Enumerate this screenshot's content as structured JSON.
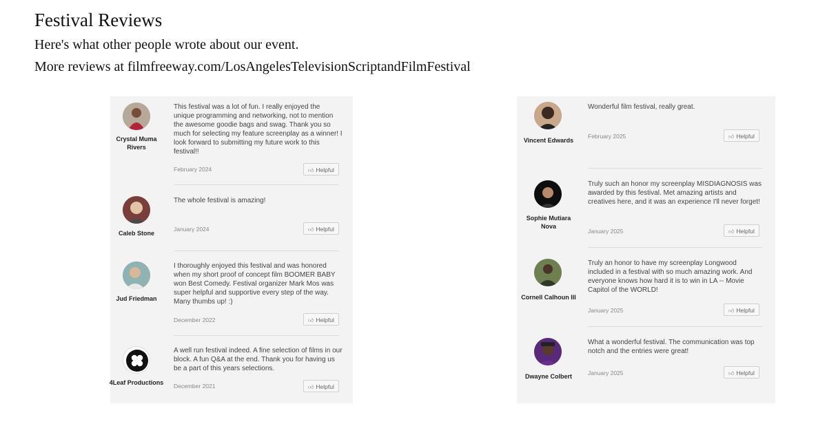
{
  "header": {
    "title": "Festival Reviews",
    "subtitle": "Here's what other people wrote about our event.",
    "more": "More reviews at filmfreeway.com/LosAngelesTelevisionScriptandFilmFestival"
  },
  "helpful_label": "Helpful",
  "left_reviews": [
    {
      "name": "Crystal Muma Rivers",
      "text": "This festival was a lot of fun. I really enjoyed the unique programming and networking, not to mention the awesome goodie bags and swag. Thank you so much for selecting my feature screenplay as a winner! I look forward to submitting my future work to this festival!!",
      "date": "February 2024",
      "avatar": "photo"
    },
    {
      "name": "Caleb Stone",
      "text": "The whole festival is amazing!",
      "date": "January 2024",
      "avatar": "photo"
    },
    {
      "name": "Jud Friedman",
      "text": "I thoroughly enjoyed this festival and was honored when my short proof of concept film BOOMER BABY won Best Comedy. Festival organizer Mark Mos was super helpful and supportive every step of the way. Many thumbs up! :)",
      "date": "December 2022",
      "avatar": "photo"
    },
    {
      "name": "4Leaf Productions",
      "text": "A well run festival indeed. A fine selection of films in our block. A fun Q&A at the end. Thank you for having us be a part of this years selections.",
      "date": "December 2021",
      "avatar": "clover-logo"
    }
  ],
  "right_reviews": [
    {
      "name": "Vincent Edwards",
      "text": "Wonderful film festival, really great.",
      "date": "February 2025",
      "avatar": "photo"
    },
    {
      "name": "Sophie Mutiara Nova",
      "text": "Truly such an honor my screenplay MISDIAGNOSIS was awarded by this festival. Met amazing artists and creatives here, and it was an experience I'll never forget!",
      "date": "January 2025",
      "avatar": "photo"
    },
    {
      "name": "Cornell Calhoun III",
      "text": "Truly an honor to have my screenplay Longwood included in a festival with so much amazing work. And everyone knows how hard it is to win in LA -- Movie Capitol of the WORLD!",
      "date": "January 2025",
      "avatar": "photo"
    },
    {
      "name": "Dwayne Colbert",
      "text": "What a wonderful festival. The communication was top notch and the entries were great!",
      "date": "January 2025",
      "avatar": "photo"
    }
  ]
}
